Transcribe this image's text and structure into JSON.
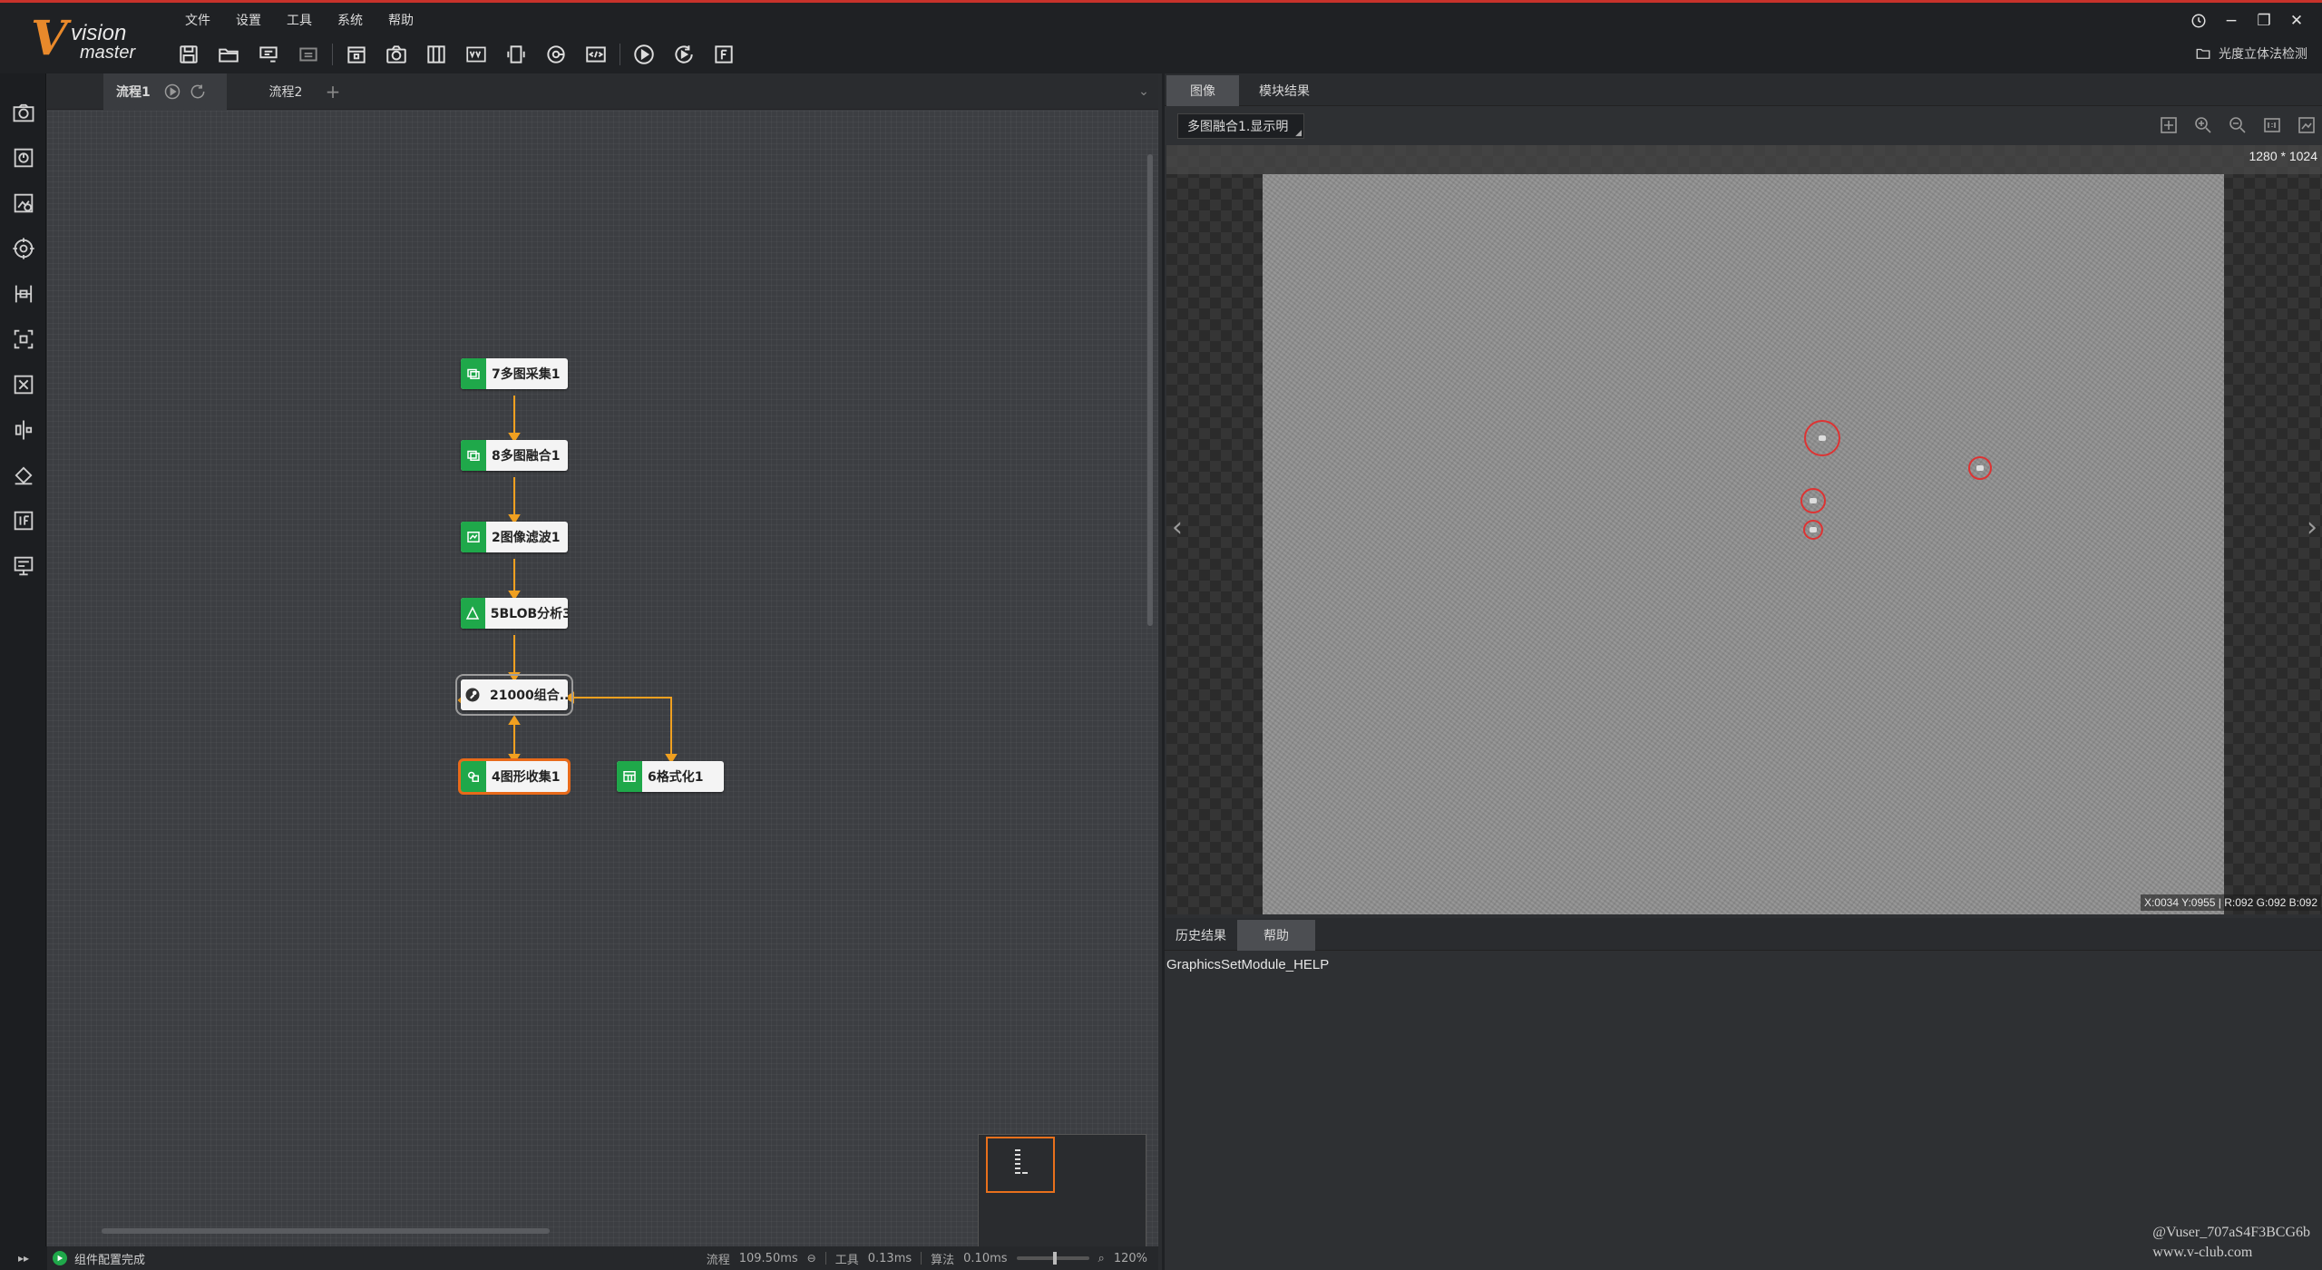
{
  "app": {
    "logo_big": "V",
    "logo_line1": "vision",
    "logo_line2": "master"
  },
  "menu": [
    "文件",
    "设置",
    "工具",
    "系统",
    "帮助"
  ],
  "toolbar": {
    "icons": [
      "save-icon",
      "open-folder-icon",
      "save-as-icon",
      "import-icon",
      "lock-icon",
      "camera-icon",
      "grid-icon",
      "var-icon",
      "device-icon",
      "global-trigger-icon",
      "script-icon",
      "run-once-icon",
      "run-loop-icon",
      "format-icon"
    ]
  },
  "window": {
    "solution_label": "光度立体法检测"
  },
  "flow": {
    "tabs": [
      "流程1",
      "流程2"
    ],
    "add_tab": "+",
    "nodes": [
      {
        "id": "n7",
        "label": "7多图采集1",
        "icon": "image-capture-icon"
      },
      {
        "id": "n8",
        "label": "8多图融合1",
        "icon": "image-fusion-icon"
      },
      {
        "id": "n2",
        "label": "2图像滤波1",
        "icon": "image-filter-icon"
      },
      {
        "id": "n5",
        "label": "5BLOB分析3",
        "icon": "blob-icon"
      },
      {
        "id": "n21",
        "label": "21000组合...",
        "icon": "wrench-icon"
      },
      {
        "id": "n4",
        "label": "4图形收集1",
        "icon": "graphics-collect-icon"
      },
      {
        "id": "n6",
        "label": "6格式化1",
        "icon": "format-icon"
      }
    ]
  },
  "status": {
    "message": "组件配置完成",
    "flow_label": "流程",
    "flow_time": "109.50ms",
    "tool_label": "工具",
    "tool_time": "0.13ms",
    "algo_label": "算法",
    "algo_time": "0.10ms",
    "zoom": "120%"
  },
  "right": {
    "tabs": [
      "图像",
      "模块结果"
    ],
    "image_source": "多图融合1.显示明",
    "resolution": "1280 * 1024",
    "pixel_info": "X:0034  Y:0955  |  R:092  G:092  B:092",
    "bottom_tabs": [
      "历史结果",
      "帮助"
    ],
    "help_text": "GraphicsSetModule_HELP",
    "watermark_line1": "@Vuser_707aS4F3BCG6b",
    "watermark_line2": "www.v-club.com"
  },
  "colors": {
    "accent": "#e8701c",
    "node_green": "#1fa84a",
    "flow_line": "#f0a020",
    "defect_red": "#dd3333"
  }
}
